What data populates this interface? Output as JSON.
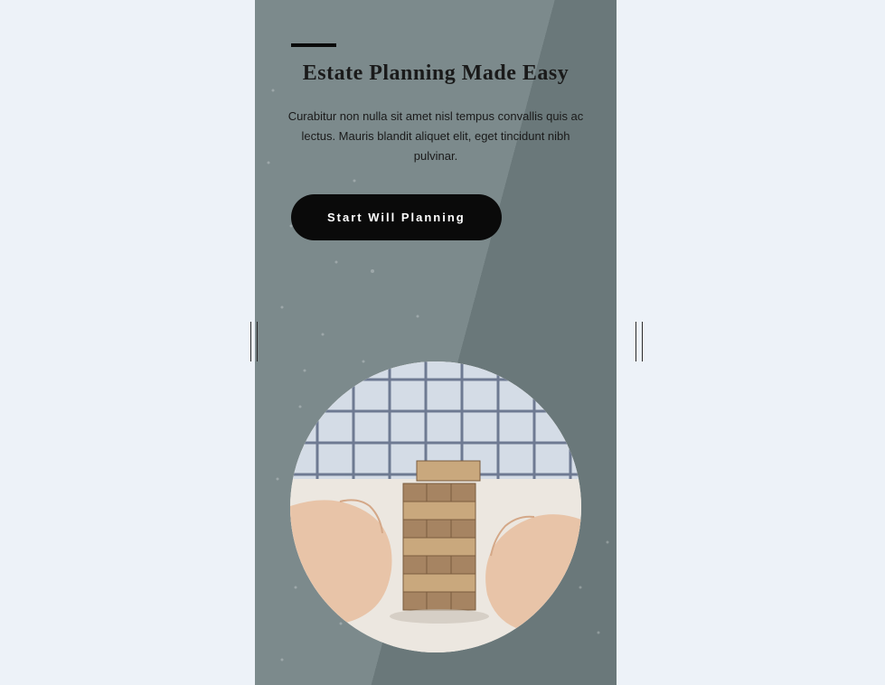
{
  "hero": {
    "heading": "Estate Planning Made Easy",
    "body": "Curabitur non nulla sit amet nisl tempus convallis quis ac lectus. Mauris blandit aliquet elit, eget tincidunt nibh pulvinar.",
    "cta_label": "Start Will Planning"
  },
  "image": {
    "alt": "Hands protecting a stack of wooden blocks"
  }
}
